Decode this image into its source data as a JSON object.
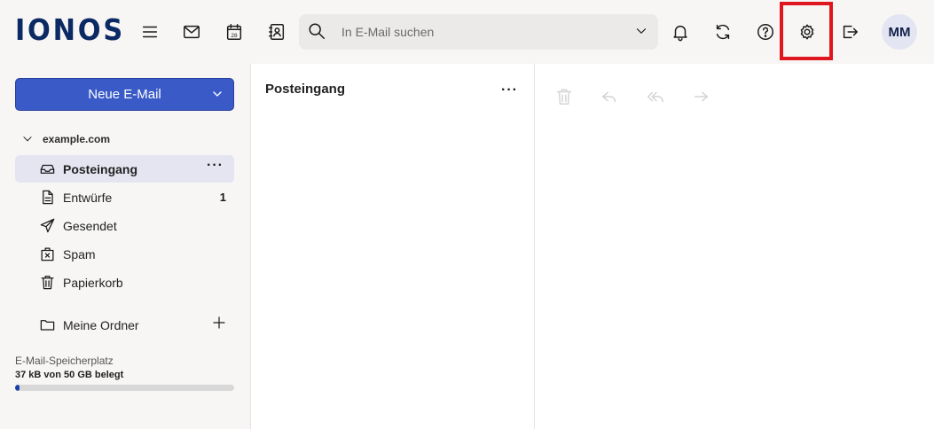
{
  "header": {
    "logo": "IONOS",
    "search": {
      "placeholder": "In E-Mail suchen"
    },
    "calendar_day": "28",
    "avatar_initials": "MM",
    "icons": [
      "menu-icon",
      "mail-icon",
      "calendar-icon",
      "contacts-icon",
      "search-icon",
      "chevron-down-icon",
      "bell-icon",
      "sync-icon",
      "help-icon",
      "gear-icon",
      "logout-icon"
    ]
  },
  "sidebar": {
    "new_mail_label": "Neue E-Mail",
    "account": "example.com",
    "folders": [
      {
        "label": "Posteingang",
        "icon": "inbox-icon",
        "active": true,
        "more": "···"
      },
      {
        "label": "Entwürfe",
        "icon": "drafts-icon",
        "count": "1"
      },
      {
        "label": "Gesendet",
        "icon": "sent-icon"
      },
      {
        "label": "Spam",
        "icon": "spam-icon"
      },
      {
        "label": "Papierkorb",
        "icon": "trash-icon"
      }
    ],
    "my_folders_label": "Meine Ordner",
    "storage": {
      "label": "E-Mail-Speicherplatz",
      "value": "37 kB von 50 GB belegt",
      "used_fraction": 0.02
    }
  },
  "list": {
    "title": "Posteingang",
    "more": "···"
  },
  "toolbar": {
    "icons": [
      "trash-icon",
      "reply-icon",
      "reply-all-icon",
      "forward-icon"
    ]
  },
  "colors": {
    "primary": "#3a5bc7",
    "logo": "#0b2a63",
    "highlight": "#e0161e",
    "storage_fill": "#1b3fa8"
  }
}
